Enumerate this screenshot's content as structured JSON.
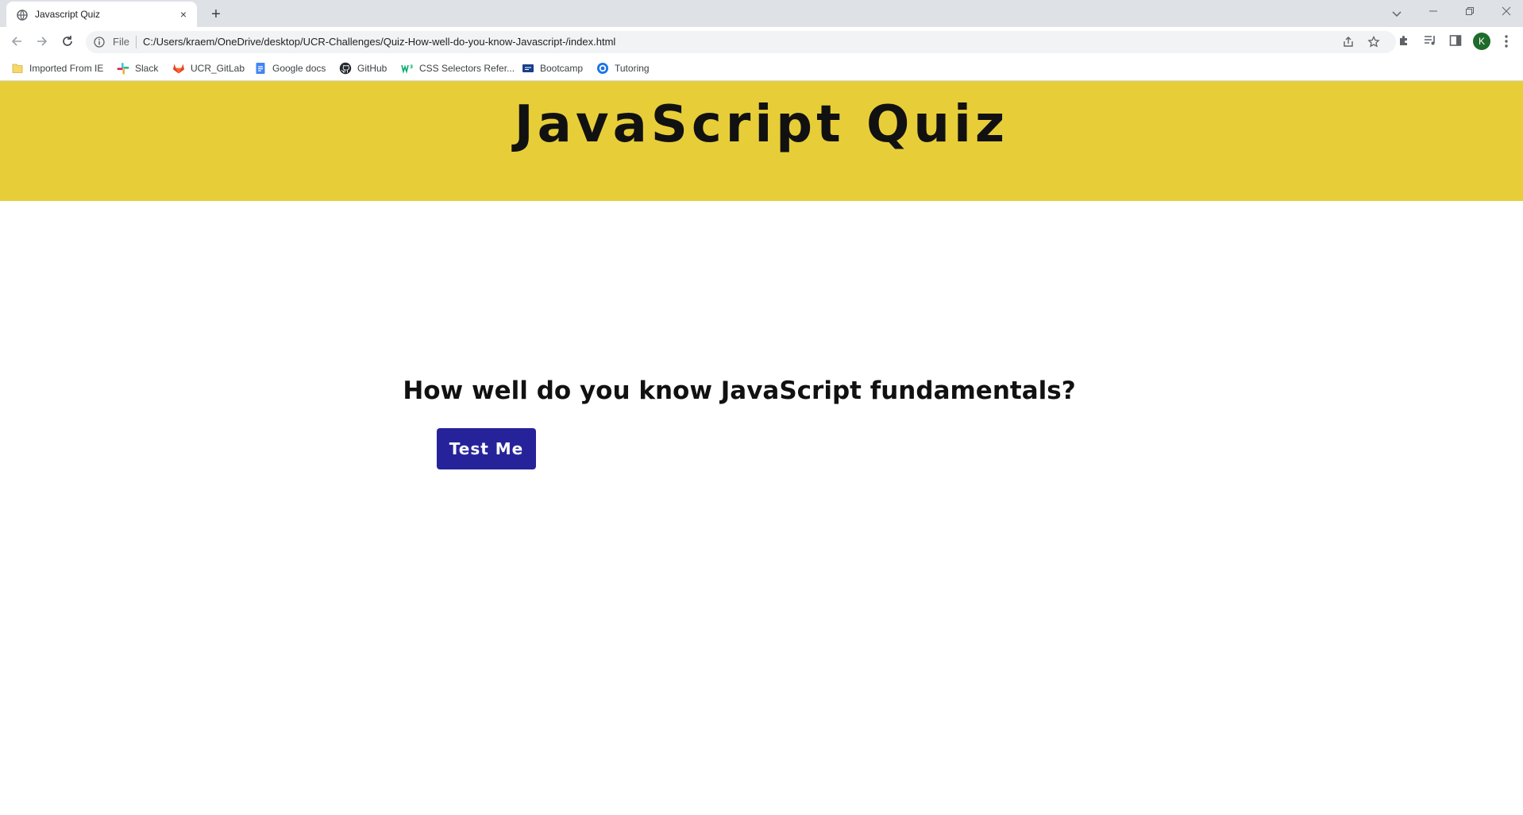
{
  "browser": {
    "tab": {
      "title": "Javascript Quiz",
      "close": "×"
    },
    "new_tab": "+",
    "address_bar": {
      "scheme_label": "File",
      "url": "C:/Users/kraem/OneDrive/desktop/UCR-Challenges/Quiz-How-well-do-you-know-Javascript-/index.html"
    },
    "profile_initial": "K",
    "bookmarks": [
      {
        "label": "Imported From IE",
        "icon": "folder-icon"
      },
      {
        "label": "Slack",
        "icon": "slack-icon"
      },
      {
        "label": "UCR_GitLab",
        "icon": "gitlab-icon"
      },
      {
        "label": "Google docs",
        "icon": "google-docs-icon"
      },
      {
        "label": "GitHub",
        "icon": "github-icon"
      },
      {
        "label": "CSS Selectors Refer...",
        "icon": "w3schools-icon"
      },
      {
        "label": "Bootcamp",
        "icon": "bootcamp-icon"
      },
      {
        "label": "Tutoring",
        "icon": "tutoring-icon"
      }
    ]
  },
  "page": {
    "title": "JavaScript Quiz",
    "question": "How well do you know JavaScript fundamentals?",
    "start_button": "Test Me"
  },
  "colors": {
    "banner": "#e7ce39",
    "button": "#26239a",
    "button_text": "#ffffff",
    "title_text": "#111111"
  }
}
